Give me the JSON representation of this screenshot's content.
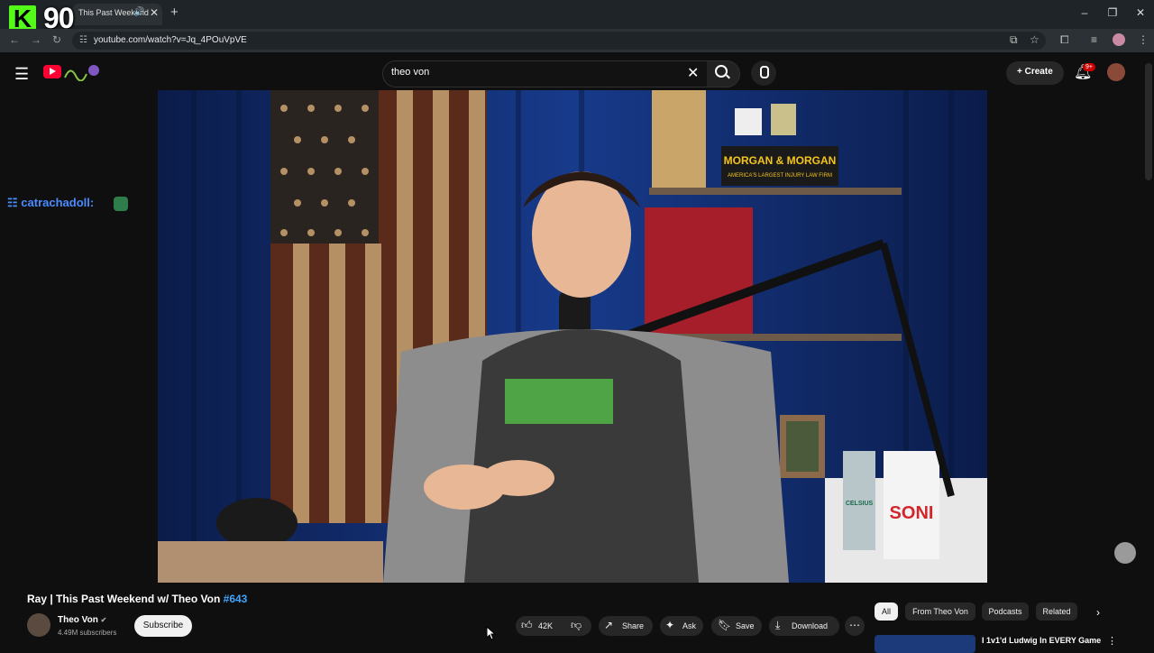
{
  "overlay": {
    "logo_letter": "K",
    "count": "90"
  },
  "browser": {
    "tab_title": "This Past Weekend",
    "url": "youtube.com/watch?v=Jq_4POuVpVE"
  },
  "header": {
    "search_query": "theo von",
    "create_label": "Create",
    "notification_badge": "9+"
  },
  "chat": {
    "username": "catrachadoll:"
  },
  "video": {
    "title": "Ray | This Past Weekend w/ Theo Von",
    "episode_tag": "#643",
    "poster_text": "MORGAN & MORGAN",
    "poster_sub": "AMERICA'S LARGEST INJURY LAW FIRM",
    "cup_text": "SONI",
    "can_text": "CELSIUS"
  },
  "channel": {
    "name": "Theo Von",
    "subscribers": "4.49M subscribers",
    "subscribe_label": "Subscribe"
  },
  "actions": {
    "likes": "42K",
    "share": "Share",
    "ask": "Ask",
    "save": "Save",
    "download": "Download"
  },
  "chips": [
    "All",
    "From Theo Von",
    "Podcasts",
    "Related"
  ],
  "recommended": {
    "title": "I 1v1'd Ludwig In EVERY Game"
  },
  "colors": {
    "accent": "#3ea6ff",
    "brand": "#ff0033",
    "kick": "#53fc18"
  }
}
